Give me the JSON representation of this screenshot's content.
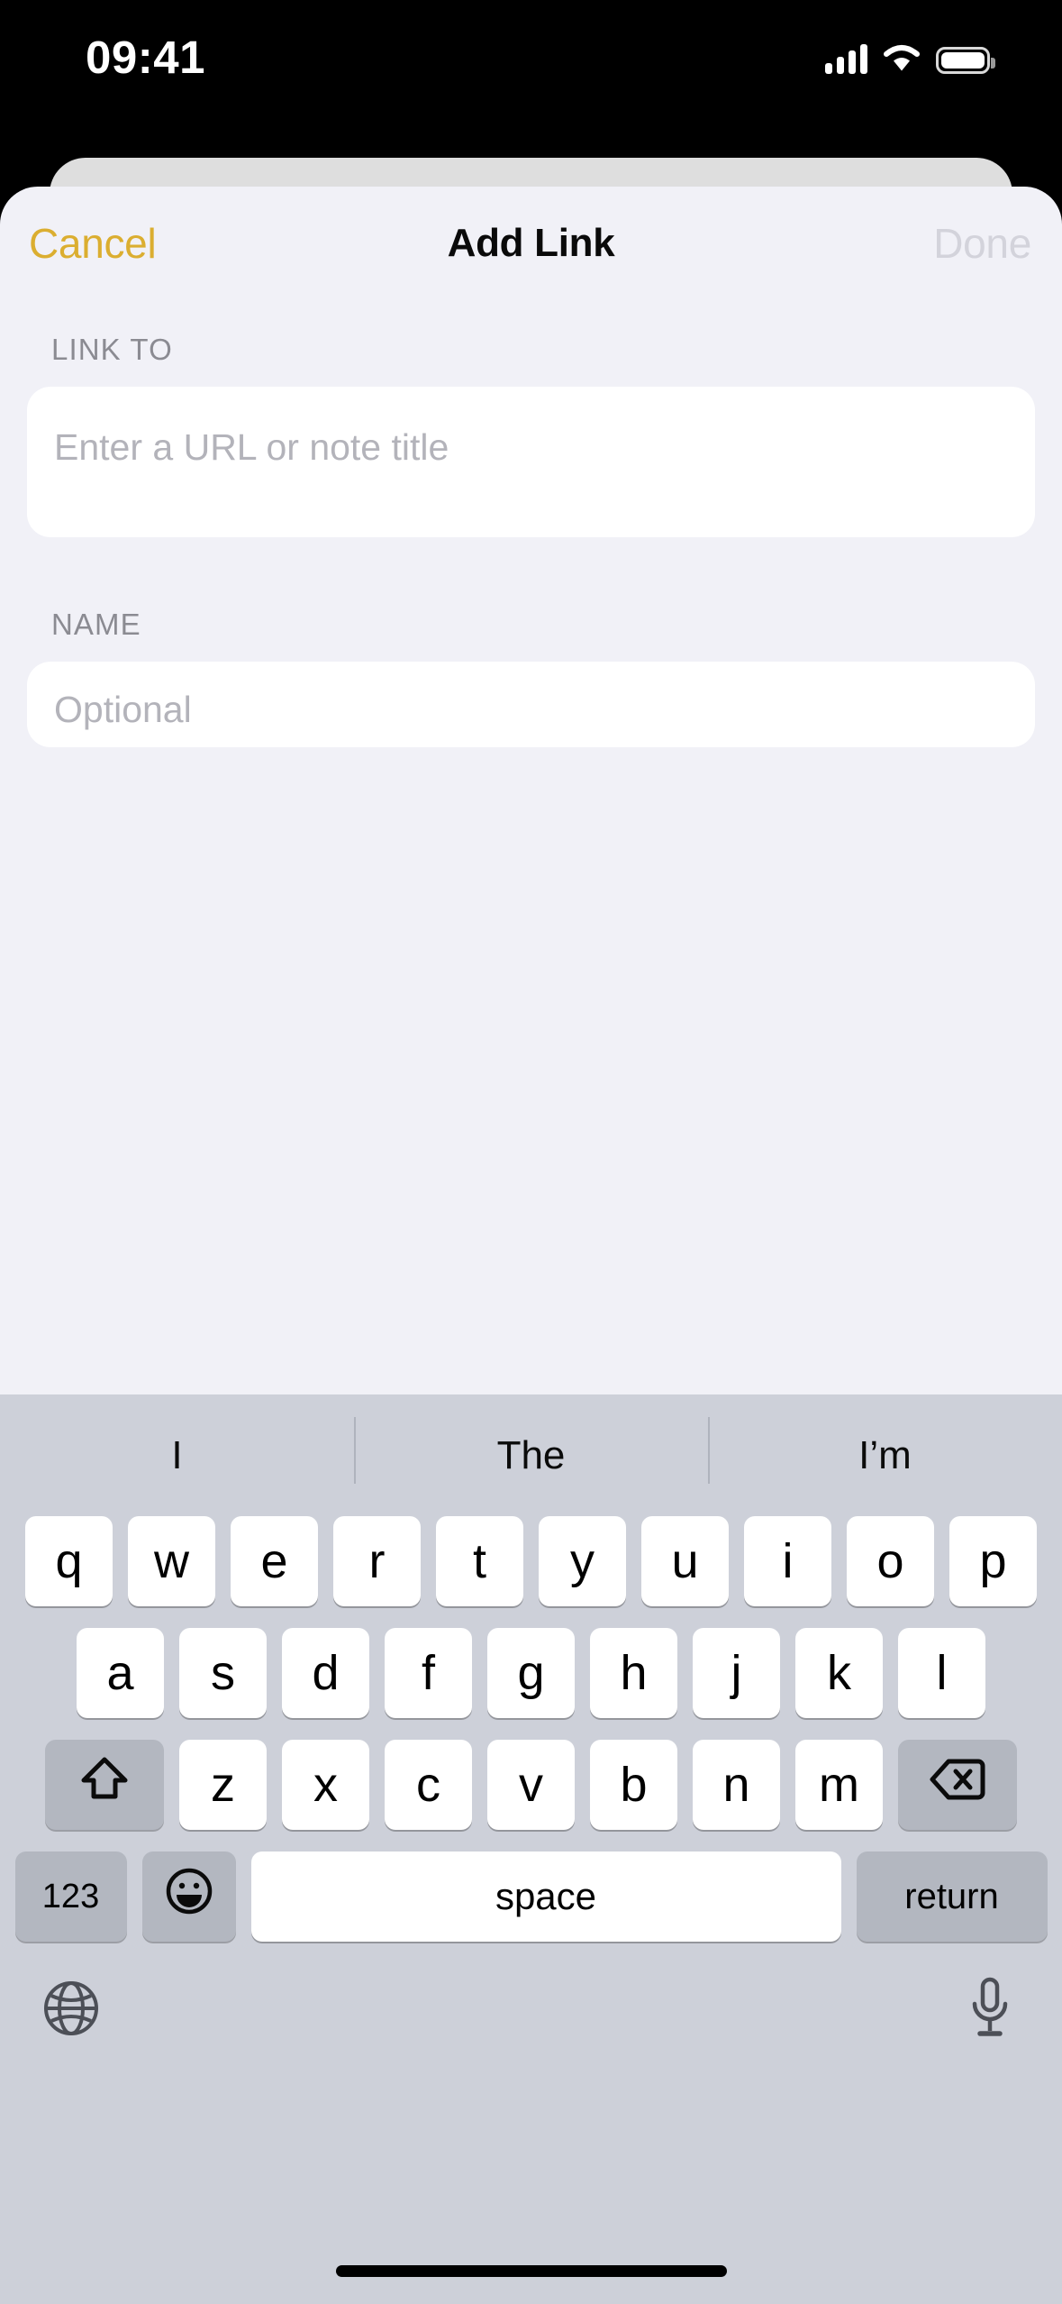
{
  "status_bar": {
    "time": "09:41",
    "icons": [
      "cellular-signal-icon",
      "wifi-icon",
      "battery-icon"
    ]
  },
  "sheet": {
    "navbar": {
      "cancel_label": "Cancel",
      "title": "Add Link",
      "done_label": "Done",
      "done_enabled": false
    },
    "fields": [
      {
        "label": "LINK TO",
        "placeholder": "Enter a URL or note title",
        "value": ""
      },
      {
        "label": "NAME",
        "placeholder": "Optional",
        "value": ""
      }
    ]
  },
  "keyboard": {
    "predictions": [
      "I",
      "The",
      "I’m"
    ],
    "row1": [
      "q",
      "w",
      "e",
      "r",
      "t",
      "y",
      "u",
      "i",
      "o",
      "p"
    ],
    "row2": [
      "a",
      "s",
      "d",
      "f",
      "g",
      "h",
      "j",
      "k",
      "l"
    ],
    "row3": [
      "z",
      "x",
      "c",
      "v",
      "b",
      "n",
      "m"
    ],
    "shift_icon": "shift-arrow-icon",
    "backspace_icon": "backspace-icon",
    "numbers_label": "123",
    "emoji_icon": "emoji-smiley-icon",
    "space_label": "space",
    "return_label": "return",
    "globe_icon": "globe-icon",
    "microphone_icon": "microphone-icon"
  },
  "colors": {
    "accent": "#DBAE30",
    "sheet_bg": "#F1F1F7",
    "keyboard_bg": "#CDD0D9",
    "key_bg": "#FFFFFF",
    "key_dark_bg": "#B3B7C0",
    "disabled_text": "#D3D3DB",
    "label_text": "#8B8B92",
    "placeholder_text": "#B3B3BA"
  }
}
